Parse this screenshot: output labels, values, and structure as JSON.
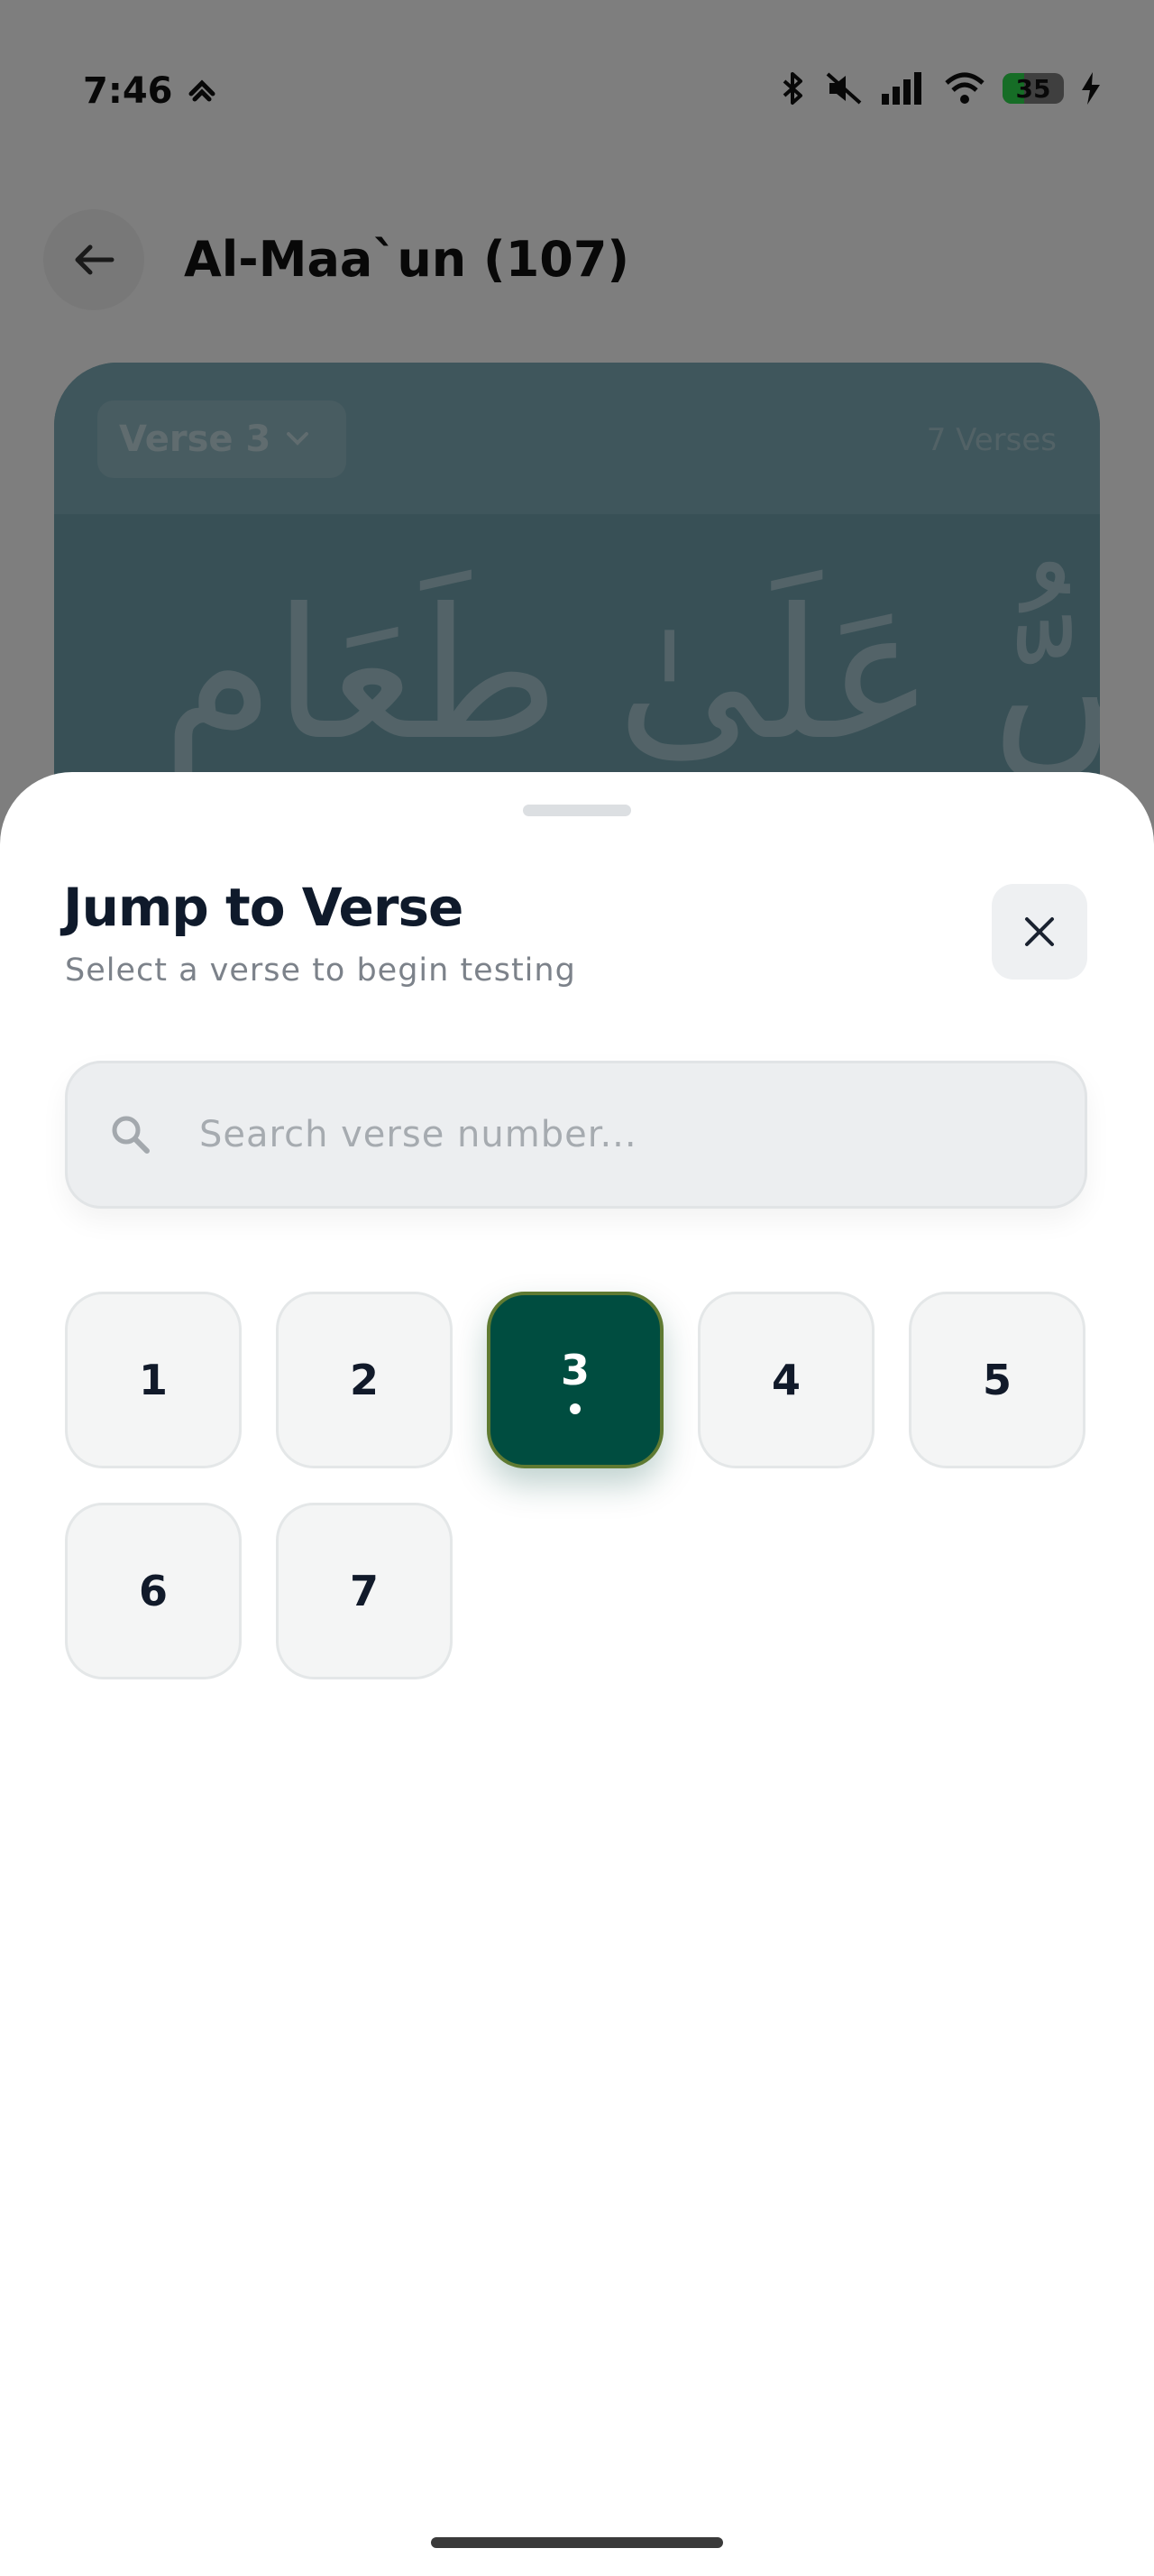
{
  "status_bar": {
    "time": "7:46",
    "battery": "35",
    "battery_level": 0.35
  },
  "header": {
    "title": "Al-Maa`un (107)",
    "back_icon": "arrow-left-icon"
  },
  "verse_card": {
    "selector_label": "Verse 3",
    "verses_count": "7 Verses",
    "arabic_text": "وَلَا يَحُضُّ عَلَىٰ طَعَامِ"
  },
  "sheet": {
    "title": "Jump to Verse",
    "subtitle": "Select a verse to begin testing",
    "close_icon": "close-icon",
    "search": {
      "placeholder": "Search verse number...",
      "value": ""
    },
    "verses": [
      "1",
      "2",
      "3",
      "4",
      "5",
      "6",
      "7"
    ],
    "current_verse": "3"
  },
  "colors": {
    "accent": "#004d40",
    "accent_border": "#5f7a32",
    "title": "#0f1a2b",
    "subtitle": "#7c828a",
    "tile_bg": "#f4f5f5"
  }
}
